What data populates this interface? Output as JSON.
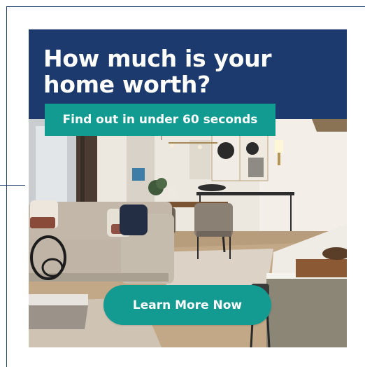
{
  "ad": {
    "headline": "How much is your home worth?",
    "subheadline": "Find out in under 60 seconds",
    "cta_label": "Learn More Now",
    "colors": {
      "header_bg": "#1c3a6d",
      "accent_teal": "#129b91",
      "text": "#ffffff"
    }
  },
  "icons": [
    "living-room-photo"
  ]
}
